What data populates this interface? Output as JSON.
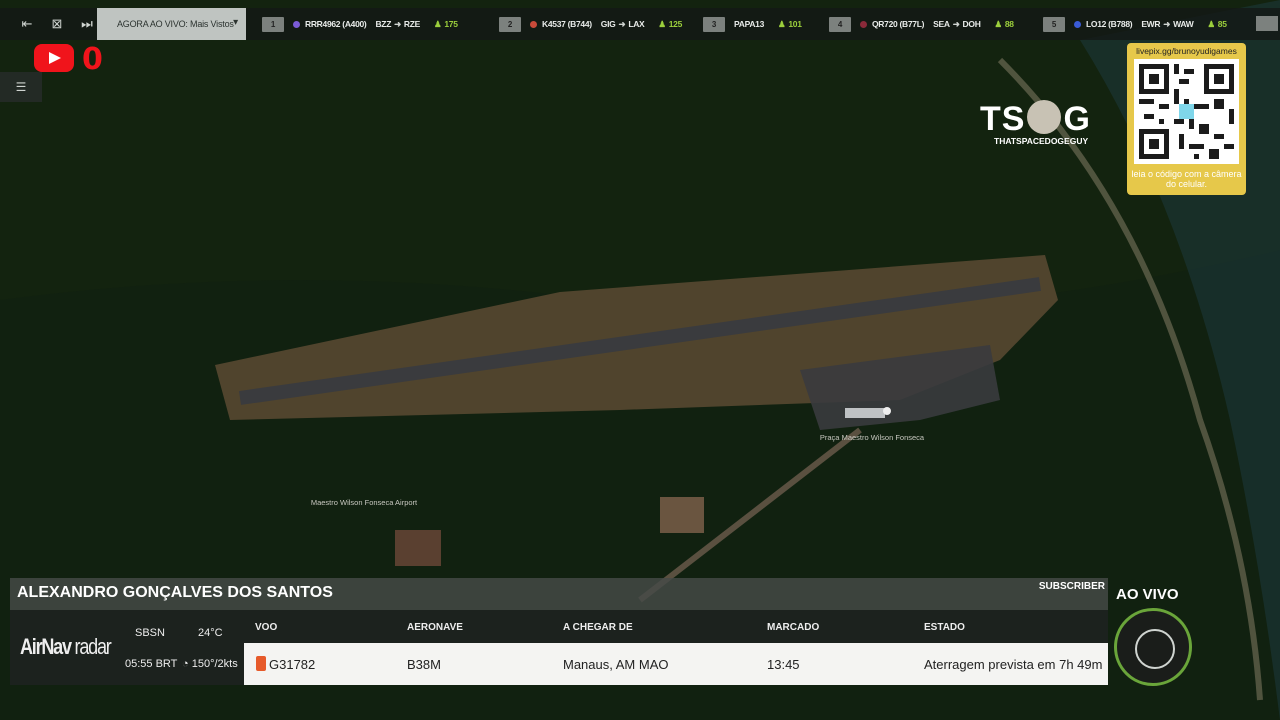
{
  "top_bar": {
    "now_live_label": "AGORA AO VIVO: Mais Vistos",
    "flights": [
      {
        "num": "1",
        "callsign": "RRR4962 (A400)",
        "route_from": "BZZ",
        "route_to": "RZE",
        "count": "175",
        "dot_color": "#7b5bd6"
      },
      {
        "num": "2",
        "callsign": "K4537 (B744)",
        "route_from": "GIG",
        "route_to": "LAX",
        "count": "125",
        "dot_color": "#c94a3a"
      },
      {
        "num": "3",
        "callsign": "PAPA13",
        "route_from": "",
        "route_to": "",
        "count": "101",
        "dot_color": ""
      },
      {
        "num": "4",
        "callsign": "QR720 (B77L)",
        "route_from": "SEA",
        "route_to": "DOH",
        "count": "88",
        "dot_color": "#8a2a3a"
      },
      {
        "num": "5",
        "callsign": "LO12 (B788)",
        "route_from": "EWR",
        "route_to": "WAW",
        "count": "85",
        "dot_color": "#3a5bd6"
      }
    ]
  },
  "youtube": {
    "count": "0"
  },
  "logo": {
    "main": "TS  G",
    "sub": "THATSPACEDOGEGUY"
  },
  "qr": {
    "url": "livepix.gg/brunoyudigames",
    "caption": "leia o código com a câmera do celular."
  },
  "map_labels": {
    "airport": "Maestro Wilson Fonseca Airport",
    "place": "Praça Maestro Wilson Fonseca"
  },
  "panel": {
    "name": "ALEXANDRO GONÇALVES DOS SANTOS",
    "subscriber": "SUBSCRIBER",
    "brand_a": "AirNav",
    "brand_b": " radar",
    "icao": "SBSN",
    "time": "05:55 BRT",
    "temp": "24°C",
    "wind": "150°/2kts",
    "headers": {
      "flight": "VOO",
      "aircraft": "AERONAVE",
      "from": "A CHEGAR DE",
      "scheduled": "MARCADO",
      "status": "ESTADO"
    },
    "row": {
      "flight": "G31782",
      "aircraft": "B38M",
      "from": "Manaus, AM MAO",
      "scheduled": "13:45",
      "status": "Aterragem prevista em 7h 49m"
    }
  },
  "live_label": "AO VIVO"
}
